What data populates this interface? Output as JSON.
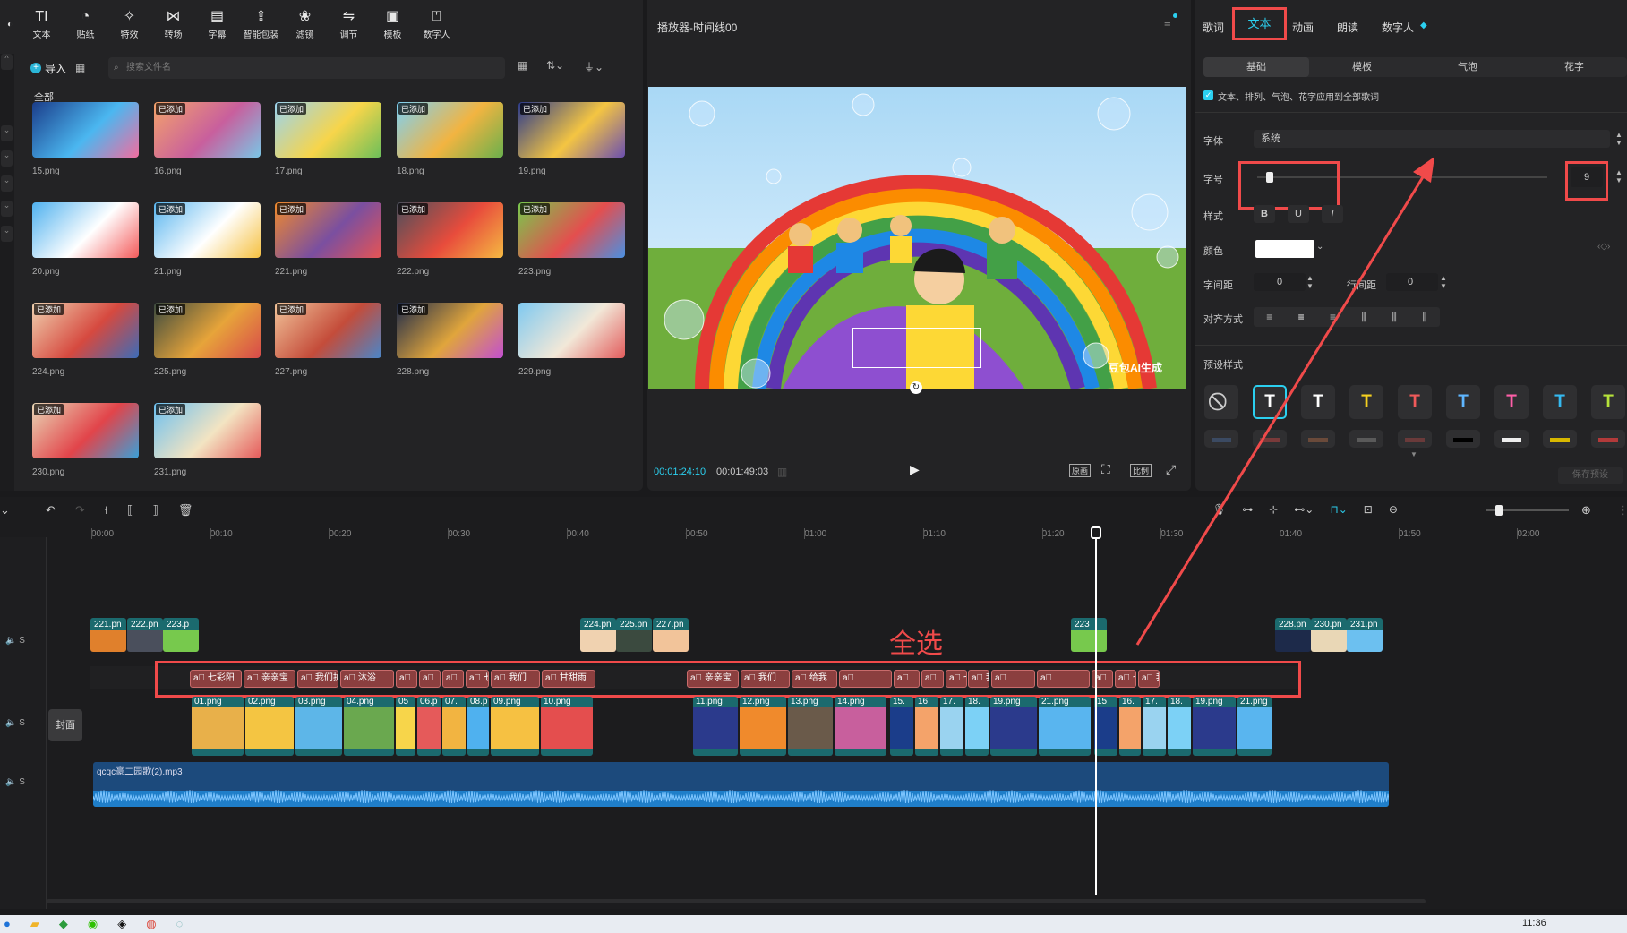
{
  "toolbar": {
    "items": [
      {
        "label": "文本",
        "icon": "TI"
      },
      {
        "label": "贴纸",
        "icon": "◔"
      },
      {
        "label": "特效",
        "icon": "✧"
      },
      {
        "label": "转场",
        "icon": "⋈"
      },
      {
        "label": "字幕",
        "icon": "▤"
      },
      {
        "label": "智能包装",
        "icon": "⇪"
      },
      {
        "label": "滤镜",
        "icon": "❀"
      },
      {
        "label": "调节",
        "icon": "⇋"
      },
      {
        "label": "模板",
        "icon": "▣"
      },
      {
        "label": "数字人",
        "icon": "⍞"
      }
    ]
  },
  "media": {
    "import_label": "导入",
    "search_placeholder": "搜索文件名",
    "all_label": "全部",
    "added_badge": "已添加",
    "items": [
      {
        "name": "15.png",
        "added": false,
        "colors": [
          "#1b3d8a",
          "#4bb7f0",
          "#f26d9f"
        ]
      },
      {
        "name": "16.png",
        "added": true,
        "colors": [
          "#f4a36a",
          "#c85f9d",
          "#7ac6e6"
        ]
      },
      {
        "name": "17.png",
        "added": true,
        "colors": [
          "#9ad3f0",
          "#f7d54a",
          "#6bbf59"
        ]
      },
      {
        "name": "18.png",
        "added": true,
        "colors": [
          "#7cd1f6",
          "#f2b441",
          "#6ab04c"
        ]
      },
      {
        "name": "19.png",
        "added": true,
        "colors": [
          "#2b3a8c",
          "#f4c542",
          "#6b4fb0"
        ]
      },
      {
        "name": "20.png",
        "added": false,
        "colors": [
          "#4fb1ef",
          "#ffffff",
          "#f45b5b"
        ]
      },
      {
        "name": "21.png",
        "added": true,
        "colors": [
          "#59b5ef",
          "#ffffff",
          "#f6c142"
        ]
      },
      {
        "name": "221.png",
        "added": true,
        "colors": [
          "#f08a2c",
          "#7a4fa0",
          "#e55454"
        ]
      },
      {
        "name": "222.png",
        "added": true,
        "colors": [
          "#4a4f5c",
          "#e84c3c",
          "#f5b942"
        ]
      },
      {
        "name": "223.png",
        "added": true,
        "colors": [
          "#77c94d",
          "#e44e4e",
          "#4a90e2"
        ]
      },
      {
        "name": "224.png",
        "added": true,
        "colors": [
          "#f0d2b0",
          "#d6493f",
          "#3c6cb8"
        ]
      },
      {
        "name": "225.png",
        "added": true,
        "colors": [
          "#3b4a3f",
          "#e7a43a",
          "#d84a4a"
        ]
      },
      {
        "name": "227.png",
        "added": true,
        "colors": [
          "#f2c49a",
          "#c44c3a",
          "#4a86c9"
        ]
      },
      {
        "name": "228.png",
        "added": true,
        "colors": [
          "#1d2a4a",
          "#e0a53c",
          "#c24fd1"
        ]
      },
      {
        "name": "229.png",
        "added": false,
        "colors": [
          "#7fc9f0",
          "#f2e8d8",
          "#e25c5c"
        ]
      },
      {
        "name": "230.png",
        "added": true,
        "colors": [
          "#e9d7b6",
          "#e2444a",
          "#3aa0d8"
        ]
      },
      {
        "name": "231.png",
        "added": true,
        "colors": [
          "#6cc0f0",
          "#f3e4c2",
          "#e55a5a"
        ]
      }
    ]
  },
  "player": {
    "title": "播放器-时间线00",
    "current_time": "00:01:24:10",
    "total_time": "00:01:49:03",
    "watermark": "豆包AI生成",
    "btn_original": "原画",
    "btn_ratio": "比例"
  },
  "props": {
    "tabs": [
      "歌词",
      "文本",
      "动画",
      "朗读",
      "数字人"
    ],
    "active_tab": "文本",
    "subtabs": [
      "基础",
      "模板",
      "气泡",
      "花字"
    ],
    "apply_all": "文本、排列、气泡、花字应用到全部歌词",
    "font_label": "字体",
    "font_value": "系统",
    "size_label": "字号",
    "size_value": "9",
    "size_fraction": 0.03,
    "style_label": "样式",
    "style_b": "B",
    "style_u": "U",
    "style_i": "I",
    "color_label": "颜色",
    "spacing_label": "字间距",
    "spacing_value": "0",
    "line_spacing_label": "行间距",
    "line_spacing_value": "0",
    "align_label": "对齐方式",
    "preset_label": "预设样式",
    "save_preset": "保存预设",
    "presets": [
      {
        "glyph": "⃠",
        "color": "#cccccc"
      },
      {
        "glyph": "T",
        "color": "#ffffff"
      },
      {
        "glyph": "T",
        "color": "#ffffff"
      },
      {
        "glyph": "T",
        "color": "#f5d020"
      },
      {
        "glyph": "T",
        "color": "#f05a5a"
      },
      {
        "glyph": "T",
        "color": "#5fb6ff"
      },
      {
        "glyph": "T",
        "color": "#ff5fa8"
      },
      {
        "glyph": "T",
        "color": "#35b9f0"
      },
      {
        "glyph": "T",
        "color": "#b6e23a"
      }
    ],
    "preset_swatches": [
      "#3b4a62",
      "#7a3a3a",
      "#6a4a3a",
      "#5a5a5a",
      "#6a3a3a",
      "#000000",
      "#eeeeee",
      "#d8b800",
      "#b23a3a"
    ]
  },
  "timeline": {
    "ticks": [
      "00:00",
      "00:10",
      "00:20",
      "00:30",
      "00:40",
      "00:50",
      "01:00",
      "01:10",
      "01:20",
      "01:30",
      "01:40",
      "01:50",
      "02:00"
    ],
    "cover_label": "封面",
    "track_s": "S",
    "select_all": "全选",
    "audio_name": "qcqc豪二园歌(2).mp3",
    "upper_clips": [
      {
        "label": "221.pn",
        "color": "#e0802c"
      },
      {
        "label": "222.pn",
        "color": "#4a4f5c"
      },
      {
        "label": "223.p",
        "color": "#77c94d"
      },
      {
        "label": "224.pn",
        "color": "#f0d2b0"
      },
      {
        "label": "225.pn",
        "color": "#3b4a3f"
      },
      {
        "label": "227.pn",
        "color": "#f2c49a"
      },
      {
        "label": "223",
        "color": "#77c94d"
      },
      {
        "label": "228.pn",
        "color": "#1d2a4a"
      },
      {
        "label": "230.pn",
        "color": "#e9d7b6"
      },
      {
        "label": "231.pn",
        "color": "#6cc0f0"
      }
    ],
    "text_clips": [
      "七彩阳",
      "亲亲宝",
      "我们护",
      "沐浴",
      "",
      "",
      "",
      "七彩天",
      "我们",
      "甘甜雨",
      "亲亲宝",
      "我们",
      "给我",
      "",
      "",
      "",
      "七彩天",
      "我们",
      "",
      "",
      "",
      "七彩天",
      "我们"
    ],
    "main_clips": [
      {
        "label": "01.png",
        "color": "#e8b04a"
      },
      {
        "label": "02.png",
        "color": "#f4c542"
      },
      {
        "label": "03.png",
        "color": "#5db6e8"
      },
      {
        "label": "04.png",
        "color": "#6aa84f"
      },
      {
        "label": "05",
        "color": "#f7d54a"
      },
      {
        "label": "06.p",
        "color": "#e55a5a"
      },
      {
        "label": "07.",
        "color": "#f2b441"
      },
      {
        "label": "08.p",
        "color": "#4fb1ef"
      },
      {
        "label": "09.png",
        "color": "#f6c142"
      },
      {
        "label": "10.png",
        "color": "#e44e4e"
      },
      {
        "label": "11.png",
        "color": "#2b3a8c"
      },
      {
        "label": "12.png",
        "color": "#f08a2c"
      },
      {
        "label": "13.png",
        "color": "#6a5a4a"
      },
      {
        "label": "14.png",
        "color": "#c85f9d"
      },
      {
        "label": "15.",
        "color": "#1b3d8a"
      },
      {
        "label": "16.",
        "color": "#f4a36a"
      },
      {
        "label": "17.",
        "color": "#9ad3f0"
      },
      {
        "label": "18.",
        "color": "#7cd1f6"
      },
      {
        "label": "19.png",
        "color": "#2b3a8c"
      },
      {
        "label": "21.png",
        "color": "#59b5ef"
      },
      {
        "label": "15",
        "color": "#1b3d8a"
      },
      {
        "label": "16.",
        "color": "#f4a36a"
      },
      {
        "label": "17.",
        "color": "#9ad3f0"
      },
      {
        "label": "18.",
        "color": "#7cd1f6"
      },
      {
        "label": "19.png",
        "color": "#2b3a8c"
      },
      {
        "label": "21.png",
        "color": "#59b5ef"
      }
    ]
  },
  "taskbar": {
    "time": "11:36"
  }
}
